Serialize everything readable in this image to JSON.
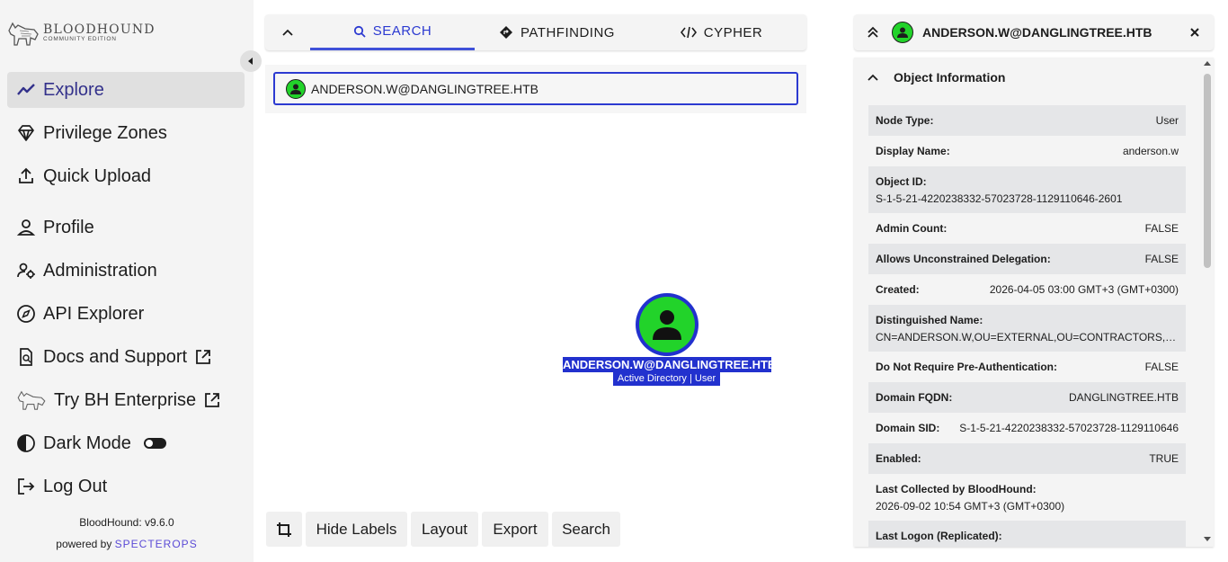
{
  "brand": {
    "name": "BLOODHOUND",
    "edition": "COMMUNITY EDITION"
  },
  "nav": {
    "explore": "Explore",
    "privilege_zones": "Privilege Zones",
    "quick_upload": "Quick Upload",
    "profile": "Profile",
    "administration": "Administration",
    "api_explorer": "API Explorer",
    "docs_support": "Docs and Support",
    "try_enterprise": "Try BH Enterprise",
    "dark_mode": "Dark Mode",
    "log_out": "Log Out"
  },
  "footer": {
    "version": "BloodHound: v9.6.0",
    "powered_by": "powered by",
    "company": "SPECTEROPS"
  },
  "search_panel": {
    "tabs": [
      "SEARCH",
      "PATHFINDING",
      "CYPHER"
    ],
    "active_tab": "SEARCH",
    "query": "ANDERSON.W@DANGLINGTREE.HTB"
  },
  "graph": {
    "node_label": "ANDERSON.W@DANGLINGTREE.HTB",
    "node_sublabel": "Active Directory | User",
    "node_color": "#22d32a",
    "selection_color": "#2231ce"
  },
  "toolbar": {
    "hide_labels": "Hide Labels",
    "layout": "Layout",
    "export": "Export",
    "search": "Search"
  },
  "entity_panel": {
    "title": "ANDERSON.W@DANGLINGTREE.HTB",
    "section_title": "Object Information",
    "properties": [
      {
        "key": "Node Type:",
        "value": "User"
      },
      {
        "key": "Display Name:",
        "value": "anderson.w"
      },
      {
        "key": "Object ID:",
        "value": "S-1-5-21-4220238332-57023728-1129110646-2601"
      },
      {
        "key": "Admin Count:",
        "value": "FALSE"
      },
      {
        "key": "Allows Unconstrained Delegation:",
        "value": "FALSE"
      },
      {
        "key": "Created:",
        "value": "2026-04-05 03:00 GMT+3 (GMT+0300)"
      },
      {
        "key": "Distinguished Name:",
        "value": "CN=ANDERSON.W,OU=EXTERNAL,OU=CONTRACTORS,DC=..."
      },
      {
        "key": "Do Not Require Pre-Authentication:",
        "value": "FALSE"
      },
      {
        "key": "Domain FQDN:",
        "value": "DANGLINGTREE.HTB"
      },
      {
        "key": "Domain SID:",
        "value": "S-1-5-21-4220238332-57023728-1129110646"
      },
      {
        "key": "Enabled:",
        "value": "TRUE"
      },
      {
        "key": "Last Collected by BloodHound:",
        "value": "2026-09-02 10:54 GMT+3 (GMT+0300)"
      },
      {
        "key": "Last Logon (Replicated):",
        "value": ""
      }
    ]
  }
}
